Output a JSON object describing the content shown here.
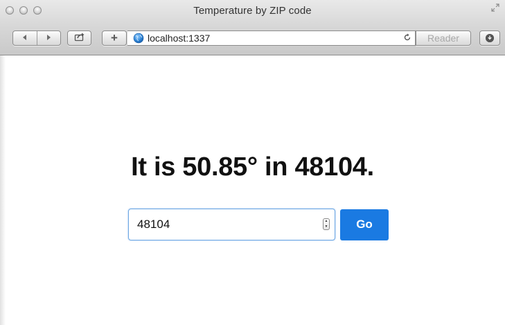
{
  "window": {
    "title": "Temperature by ZIP code"
  },
  "toolbar": {
    "back_icon": "back-arrow-icon",
    "forward_icon": "forward-arrow-icon",
    "share_icon": "share-icon",
    "add_label": "+",
    "reload_icon": "reload-icon",
    "reader_label": "Reader",
    "download_icon": "download-icon"
  },
  "address_bar": {
    "url": "localhost:1337",
    "site_icon": "globe-icon"
  },
  "main": {
    "headline": "It is 50.85° in 48104.",
    "zip_input_value": "48104",
    "go_label": "Go"
  },
  "colors": {
    "button_blue": "#1a7ae2",
    "input_focus_border": "#6da7e3"
  }
}
